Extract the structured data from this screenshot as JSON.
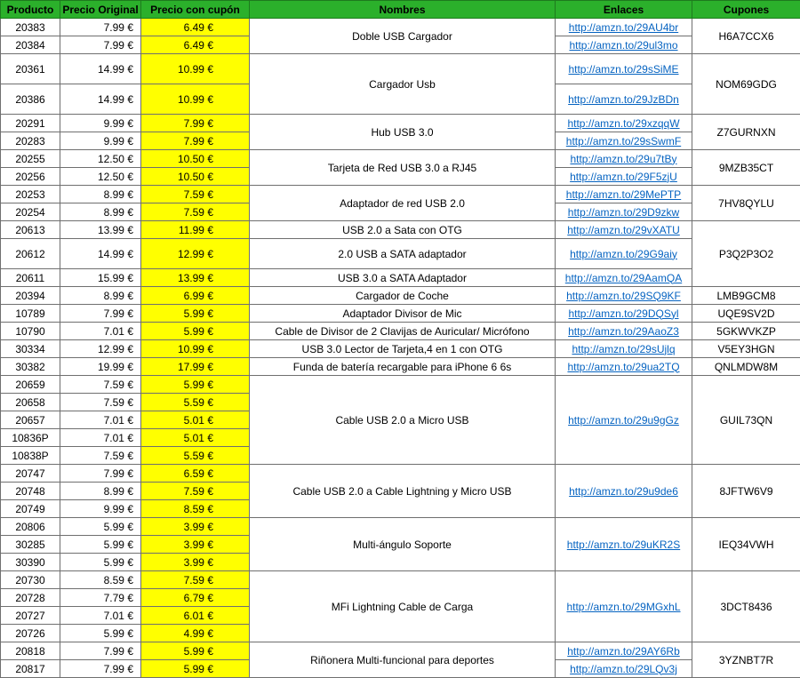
{
  "headers": {
    "producto": "Producto",
    "precio_original": "Precio Original",
    "precio_cupon": "Precio con cupón",
    "nombres": "Nombres",
    "enlaces": "Enlaces",
    "cupones": "Cupones"
  },
  "colors": {
    "header_bg": "#2bb02b",
    "coupon_bg": "#ffff00",
    "link": "#0563c1"
  },
  "rows": [
    {
      "producto": "20383",
      "original": "7.99 €",
      "cupon": "6.49 €",
      "enlace": "http://amzn.to/29AU4br"
    },
    {
      "producto": "20384",
      "original": "7.99 €",
      "cupon": "6.49 €",
      "enlace": "http://amzn.to/29ul3mo"
    },
    {
      "producto": "20361",
      "original": "14.99 €",
      "cupon": "10.99 €",
      "enlace": "http://amzn.to/29sSiME"
    },
    {
      "producto": "20386",
      "original": "14.99 €",
      "cupon": "10.99 €",
      "enlace": "http://amzn.to/29JzBDn"
    },
    {
      "producto": "20291",
      "original": "9.99 €",
      "cupon": "7.99 €",
      "enlace": "http://amzn.to/29xzqqW"
    },
    {
      "producto": "20283",
      "original": "9.99 €",
      "cupon": "7.99 €",
      "enlace": "http://amzn.to/29sSwmF"
    },
    {
      "producto": "20255",
      "original": "12.50 €",
      "cupon": "10.50 €",
      "enlace": "http://amzn.to/29u7tBy"
    },
    {
      "producto": "20256",
      "original": "12.50 €",
      "cupon": "10.50 €",
      "enlace": "http://amzn.to/29F5zjU"
    },
    {
      "producto": "20253",
      "original": "8.99 €",
      "cupon": "7.59 €",
      "enlace": "http://amzn.to/29MePTP"
    },
    {
      "producto": "20254",
      "original": "8.99 €",
      "cupon": "7.59 €",
      "enlace": "http://amzn.to/29D9zkw"
    },
    {
      "producto": "20613",
      "original": "13.99 €",
      "cupon": "11.99 €",
      "enlace": "http://amzn.to/29vXATU"
    },
    {
      "producto": "20612",
      "original": "14.99 €",
      "cupon": "12.99 €",
      "enlace": "http://amzn.to/29G9aiy"
    },
    {
      "producto": "20611",
      "original": "15.99 €",
      "cupon": "13.99 €",
      "enlace": "http://amzn.to/29AamQA"
    },
    {
      "producto": "20394",
      "original": "8.99 €",
      "cupon": "6.99 €",
      "enlace": "http://amzn.to/29SQ9KF"
    },
    {
      "producto": "10789",
      "original": "7.99 €",
      "cupon": "5.99 €",
      "enlace": "http://amzn.to/29DQSyl"
    },
    {
      "producto": "10790",
      "original": "7.01 €",
      "cupon": "5.99 €",
      "enlace": "http://amzn.to/29AaoZ3"
    },
    {
      "producto": "30334",
      "original": "12.99 €",
      "cupon": "10.99 €",
      "enlace": "http://amzn.to/29sUjlq"
    },
    {
      "producto": "30382",
      "original": "19.99 €",
      "cupon": "17.99 €",
      "enlace": "http://amzn.to/29ua2TQ"
    },
    {
      "producto": "20659",
      "original": "7.59 €",
      "cupon": "5.99 €"
    },
    {
      "producto": "20658",
      "original": "7.59 €",
      "cupon": "5.59 €"
    },
    {
      "producto": "20657",
      "original": "7.01 €",
      "cupon": "5.01 €",
      "enlace": "http://amzn.to/29u9gGz"
    },
    {
      "producto": "10836P",
      "original": "7.01 €",
      "cupon": "5.01 €"
    },
    {
      "producto": "10838P",
      "original": "7.59 €",
      "cupon": "5.59 €"
    },
    {
      "producto": "20747",
      "original": "7.99 €",
      "cupon": "6.59 €"
    },
    {
      "producto": "20748",
      "original": "8.99 €",
      "cupon": "7.59 €",
      "enlace": "http://amzn.to/29u9de6"
    },
    {
      "producto": "20749",
      "original": "9.99 €",
      "cupon": "8.59 €"
    },
    {
      "producto": "20806",
      "original": "5.99 €",
      "cupon": "3.99 €"
    },
    {
      "producto": "30285",
      "original": "5.99 €",
      "cupon": "3.99 €",
      "enlace": "http://amzn.to/29uKR2S"
    },
    {
      "producto": "30390",
      "original": "5.99 €",
      "cupon": "3.99 €"
    },
    {
      "producto": "20730",
      "original": "8.59 €",
      "cupon": "7.59 €"
    },
    {
      "producto": "20728",
      "original": "7.79 €",
      "cupon": "6.79 €"
    },
    {
      "producto": "20727",
      "original": "7.01 €",
      "cupon": "6.01 €",
      "enlace": "http://amzn.to/29MGxhL"
    },
    {
      "producto": "20726",
      "original": "5.99 €",
      "cupon": "4.99 €"
    },
    {
      "producto": "20818",
      "original": "7.99 €",
      "cupon": "5.99 €",
      "enlace": "http://amzn.to/29AY6Rb"
    },
    {
      "producto": "20817",
      "original": "7.99 €",
      "cupon": "5.99 €",
      "enlace": "http://amzn.to/29LQv3j"
    }
  ],
  "groups": [
    {
      "nombre": "Doble USB Cargador",
      "cupon": "H6A7CCX6"
    },
    {
      "nombre": "Cargador Usb",
      "cupon": "NOM69GDG"
    },
    {
      "nombre": "Hub USB 3.0",
      "cupon": "Z7GURNXN"
    },
    {
      "nombre": "Tarjeta de Red USB 3.0 a RJ45",
      "cupon": "9MZB35CT"
    },
    {
      "nombre": "Adaptador de red USB 2.0",
      "cupon": "7HV8QYLU"
    },
    {
      "nombre": "USB 2.0 a Sata con OTG",
      "cupon": "P3Q2P3O2"
    },
    {
      "nombre": "2.0 USB a SATA adaptador"
    },
    {
      "nombre": "USB 3.0 a SATA Adaptador"
    },
    {
      "nombre": "Cargador de Coche",
      "cupon": "LMB9GCM8"
    },
    {
      "nombre": "Adaptador Divisor de Mic",
      "cupon": "UQE9SV2D"
    },
    {
      "nombre": "Cable de Divisor de 2 Clavijas de Auricular/ Micrófono",
      "cupon": "5GKWVKZP"
    },
    {
      "nombre": "USB 3.0 Lector de Tarjeta,4 en 1 con OTG",
      "cupon": "V5EY3HGN"
    },
    {
      "nombre": "Funda de batería recargable para iPhone 6 6s",
      "cupon": "QNLMDW8M"
    },
    {
      "nombre": "Cable USB 2.0 a Micro USB",
      "cupon": "GUIL73QN"
    },
    {
      "nombre": "Cable USB 2.0 a Cable Lightning y Micro USB",
      "cupon": "8JFTW6V9"
    },
    {
      "nombre": "Multi-ángulo Soporte",
      "cupon": "IEQ34VWH"
    },
    {
      "nombre": "MFi Lightning Cable de Carga",
      "cupon": "3DCT8436"
    },
    {
      "nombre": "Riñonera Multi-funcional para deportes",
      "cupon": "3YZNBT7R"
    }
  ]
}
